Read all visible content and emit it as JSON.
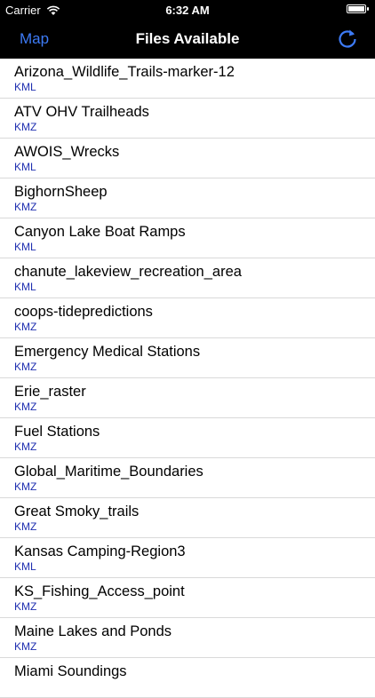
{
  "status": {
    "carrier": "Carrier",
    "time": "6:32 AM"
  },
  "nav": {
    "left": "Map",
    "title": "Files Available"
  },
  "files": [
    {
      "name": "Arizona_Wildlife_Trails-marker-12",
      "type": "KML"
    },
    {
      "name": "ATV OHV Trailheads",
      "type": "KMZ"
    },
    {
      "name": "AWOIS_Wrecks",
      "type": "KML"
    },
    {
      "name": "BighornSheep",
      "type": "KMZ"
    },
    {
      "name": "Canyon Lake Boat Ramps",
      "type": "KML"
    },
    {
      "name": "chanute_lakeview_recreation_area",
      "type": "KML"
    },
    {
      "name": "coops-tidepredictions",
      "type": "KMZ"
    },
    {
      "name": "Emergency Medical Stations",
      "type": "KMZ"
    },
    {
      "name": "Erie_raster",
      "type": "KMZ"
    },
    {
      "name": "Fuel Stations",
      "type": "KMZ"
    },
    {
      "name": "Global_Maritime_Boundaries",
      "type": "KMZ"
    },
    {
      "name": "Great Smoky_trails",
      "type": "KMZ"
    },
    {
      "name": "Kansas Camping-Region3",
      "type": "KML"
    },
    {
      "name": "KS_Fishing_Access_point",
      "type": "KMZ"
    },
    {
      "name": "Maine Lakes and Ponds",
      "type": "KMZ"
    },
    {
      "name": "Miami Soundings",
      "type": ""
    }
  ]
}
